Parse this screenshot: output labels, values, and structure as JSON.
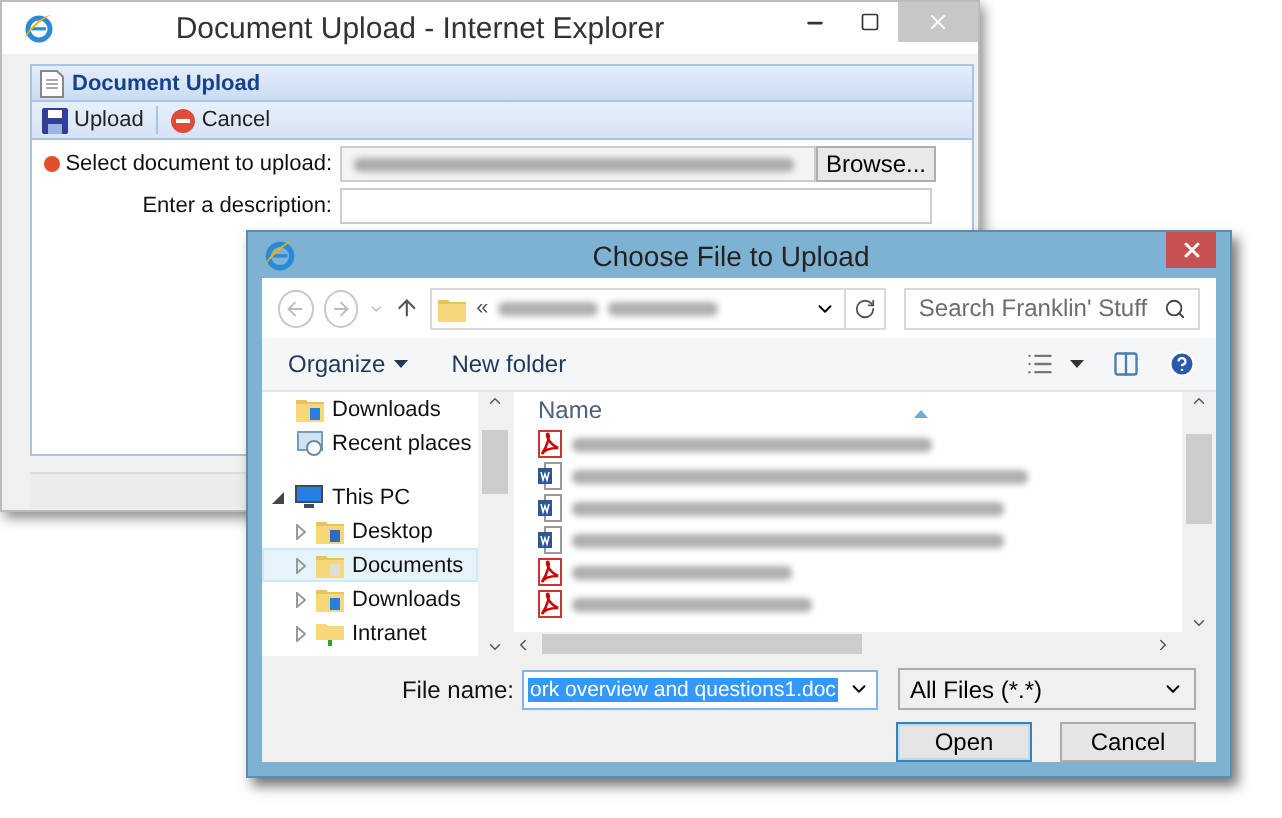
{
  "browser_window": {
    "title": "Document Upload - Internet Explorer"
  },
  "panel": {
    "title": "Document Upload",
    "toolbar": [
      {
        "label": "Upload",
        "kind": "save"
      },
      {
        "label": "Cancel",
        "kind": "cancel"
      }
    ],
    "fields": [
      {
        "label": "Select document to upload:",
        "required": true,
        "kind": "file",
        "button": "Browse..."
      },
      {
        "label": "Enter a description:",
        "required": false,
        "kind": "text"
      }
    ]
  },
  "dialog": {
    "title": "Choose File to Upload",
    "address": {
      "prefix": "«"
    },
    "search": {
      "placeholder": "Search Franklin' Stuff"
    },
    "toolbar": [
      {
        "label": "Organize",
        "menu": true
      },
      {
        "label": "New folder",
        "menu": false
      }
    ],
    "nav": [
      {
        "label": "Downloads",
        "kind": "downloads",
        "selected": false
      },
      {
        "label": "Recent places",
        "kind": "recent",
        "selected": false
      },
      {
        "label": "This PC",
        "kind": "pc",
        "selected": false,
        "expanded": true,
        "children": [
          {
            "label": "Desktop",
            "kind": "desktop",
            "selected": false,
            "expanded": false
          },
          {
            "label": "Documents",
            "kind": "documents",
            "selected": true,
            "expanded": false
          },
          {
            "label": "Downloads",
            "kind": "downloads",
            "selected": false,
            "expanded": false
          },
          {
            "label": "Intranet",
            "kind": "network",
            "selected": false,
            "expanded": false
          }
        ]
      }
    ],
    "list": {
      "column": "Name",
      "rows": [
        {
          "kind": "pdf"
        },
        {
          "kind": "word"
        },
        {
          "kind": "word"
        },
        {
          "kind": "word"
        },
        {
          "kind": "pdf"
        },
        {
          "kind": "pdf"
        }
      ]
    },
    "file_name": {
      "label": "File name:",
      "value": "ork overview and questions1.doc"
    },
    "filter": {
      "value": "All Files (*.*)"
    },
    "buttons": [
      {
        "label": "Open",
        "default": true
      },
      {
        "label": "Cancel",
        "default": false
      }
    ]
  }
}
